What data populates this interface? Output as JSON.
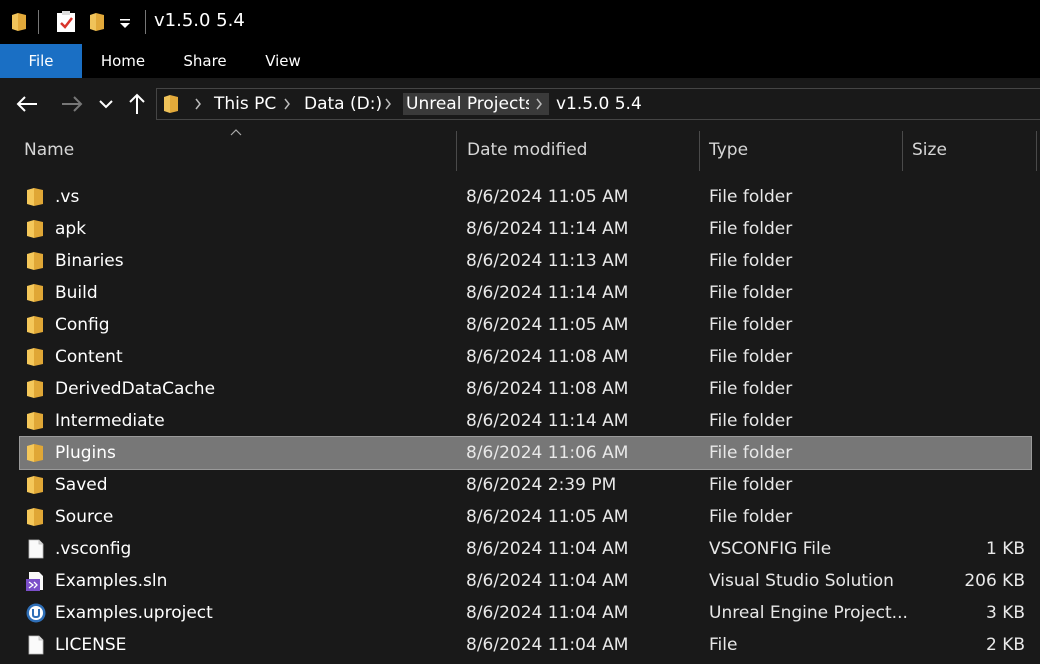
{
  "window": {
    "title": "v1.5.0 5.4"
  },
  "ribbon": {
    "tabs": [
      {
        "label": "File",
        "active": true
      },
      {
        "label": "Home"
      },
      {
        "label": "Share"
      },
      {
        "label": "View"
      }
    ]
  },
  "address": {
    "crumbs": [
      "This PC",
      "Data (D:)",
      "Unreal Projects",
      "v1.5.0 5.4"
    ]
  },
  "columns": {
    "name": "Name",
    "date": "Date modified",
    "type": "Type",
    "size": "Size"
  },
  "files": [
    {
      "name": ".vs",
      "date": "8/6/2024 11:05 AM",
      "type": "File folder",
      "size": "",
      "icon": "folder-icon"
    },
    {
      "name": "apk",
      "date": "8/6/2024 11:14 AM",
      "type": "File folder",
      "size": "",
      "icon": "folder-icon"
    },
    {
      "name": "Binaries",
      "date": "8/6/2024 11:13 AM",
      "type": "File folder",
      "size": "",
      "icon": "folder-icon"
    },
    {
      "name": "Build",
      "date": "8/6/2024 11:14 AM",
      "type": "File folder",
      "size": "",
      "icon": "folder-icon"
    },
    {
      "name": "Config",
      "date": "8/6/2024 11:05 AM",
      "type": "File folder",
      "size": "",
      "icon": "folder-icon"
    },
    {
      "name": "Content",
      "date": "8/6/2024 11:08 AM",
      "type": "File folder",
      "size": "",
      "icon": "folder-icon"
    },
    {
      "name": "DerivedDataCache",
      "date": "8/6/2024 11:08 AM",
      "type": "File folder",
      "size": "",
      "icon": "folder-icon"
    },
    {
      "name": "Intermediate",
      "date": "8/6/2024 11:14 AM",
      "type": "File folder",
      "size": "",
      "icon": "folder-icon"
    },
    {
      "name": "Plugins",
      "date": "8/6/2024 11:06 AM",
      "type": "File folder",
      "size": "",
      "icon": "folder-icon",
      "selected": true
    },
    {
      "name": "Saved",
      "date": "8/6/2024 2:39 PM",
      "type": "File folder",
      "size": "",
      "icon": "folder-icon"
    },
    {
      "name": "Source",
      "date": "8/6/2024 11:05 AM",
      "type": "File folder",
      "size": "",
      "icon": "folder-icon"
    },
    {
      "name": ".vsconfig",
      "date": "8/6/2024 11:04 AM",
      "type": "VSCONFIG File",
      "size": "1 KB",
      "icon": "file-icon"
    },
    {
      "name": "Examples.sln",
      "date": "8/6/2024 11:04 AM",
      "type": "Visual Studio Solution",
      "size": "206 KB",
      "icon": "visual-studio-icon"
    },
    {
      "name": "Examples.uproject",
      "date": "8/6/2024 11:04 AM",
      "type": "Unreal Engine Project...",
      "size": "3 KB",
      "icon": "unreal-engine-icon"
    },
    {
      "name": "LICENSE",
      "date": "8/6/2024 11:04 AM",
      "type": "File",
      "size": "2 KB",
      "icon": "file-icon"
    }
  ],
  "colors": {
    "accent": "#1a6fc4",
    "folder": "#f5c85a",
    "selected_row": "#777777"
  }
}
